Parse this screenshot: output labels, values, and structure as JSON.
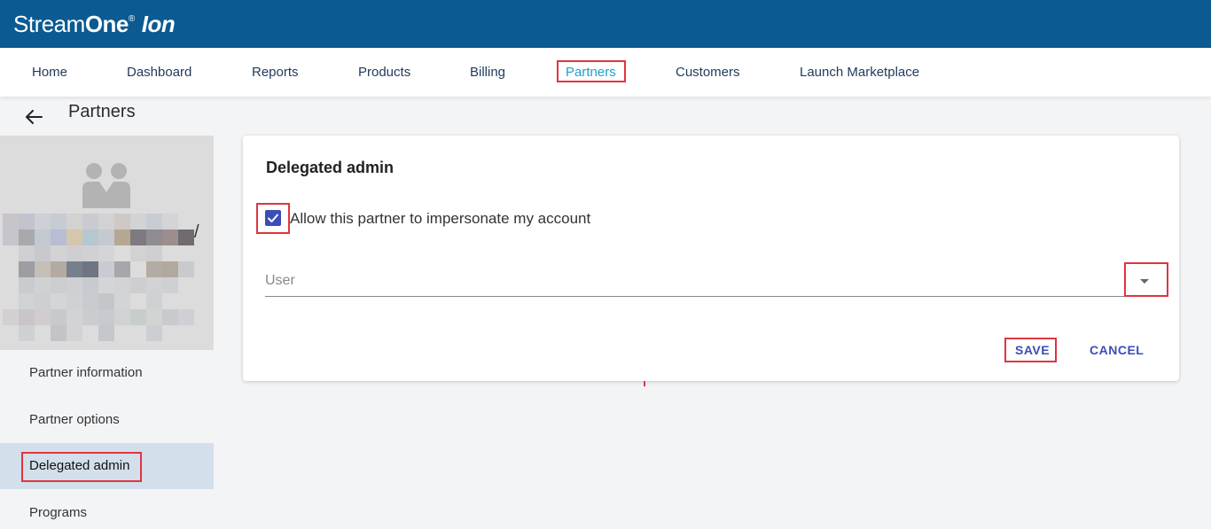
{
  "brand": {
    "part1": "Stream",
    "part2": "One",
    "reg": "®",
    "part3": "Ion"
  },
  "nav": [
    {
      "label": "Home"
    },
    {
      "label": "Dashboard"
    },
    {
      "label": "Reports"
    },
    {
      "label": "Products"
    },
    {
      "label": "Billing"
    },
    {
      "label": "Partners"
    },
    {
      "label": "Customers"
    },
    {
      "label": "Launch Marketplace"
    }
  ],
  "page": {
    "title": "Partners"
  },
  "profile": {
    "slash": "/"
  },
  "sidebar": [
    {
      "label": "Partner information"
    },
    {
      "label": "Partner options"
    },
    {
      "label": "Delegated admin"
    },
    {
      "label": "Programs"
    }
  ],
  "card": {
    "title": "Delegated admin",
    "checkbox_label": "Allow this partner to impersonate my account",
    "checkbox_checked": true,
    "user_placeholder": "User",
    "save_label": "SAVE",
    "cancel_label": "CANCEL"
  },
  "colors": {
    "header": "#0b5a92",
    "accent": "#3b4db8",
    "active_nav": "#1ea0c8",
    "highlight": "#e0353f"
  }
}
